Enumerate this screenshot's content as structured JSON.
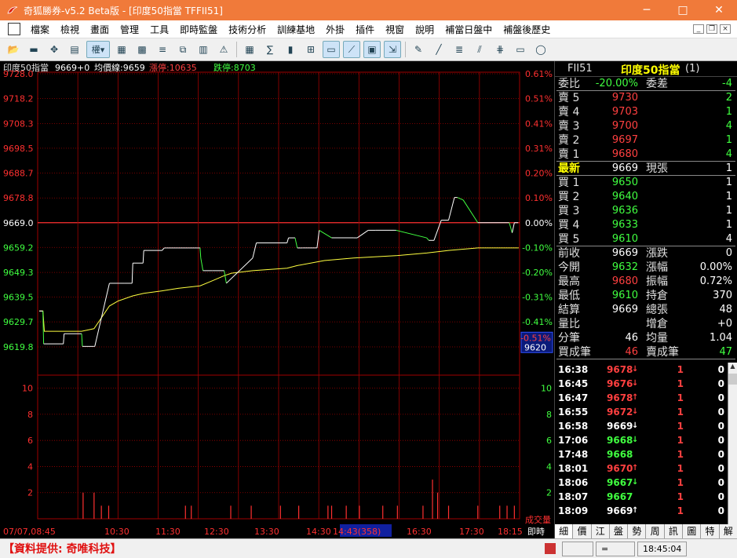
{
  "window": {
    "title": "奇狐勝券-v5.2 Beta版 - [印度50指當 TFFII51]",
    "minimize": "─",
    "maximize": "□",
    "close": "✕"
  },
  "menu": [
    "檔案",
    "檢視",
    "畫面",
    "管理",
    "工具",
    "即時監盤",
    "技術分析",
    "訓練基地",
    "外掛",
    "插件",
    "視窗",
    "說明",
    "補當日盤中",
    "補盤後歷史"
  ],
  "toolbar": {
    "weight_label": "權▾",
    "icons": [
      "open-folder-icon",
      "save-icon",
      "move-icon",
      "layout-icon",
      "weight-icon",
      "chart-grid-icon",
      "chart-grid2-icon",
      "list-icon",
      "layers-icon",
      "db-icon",
      "warning-icon",
      "table-icon",
      "sum-icon",
      "bar-chart-icon",
      "ticker-icon",
      "minute-chart-icon",
      "line-chart-icon",
      "window-icon",
      "export-icon",
      "drawing-icon",
      "line-tool-icon",
      "fib-icon",
      "fan-icon",
      "channel-icon",
      "rect-tool-icon",
      "ellipse-tool-icon"
    ]
  },
  "info_bar": {
    "name": "印度50指當",
    "price": "9669",
    "change": "+0",
    "avg_label": "均價線:9659",
    "limit_up": "漲停:10635",
    "limit_down": "跌停:8703"
  },
  "chart_data": {
    "type": "line",
    "title": "",
    "price_axis": [
      9728.0,
      9718.2,
      9708.3,
      9698.5,
      9688.7,
      9678.8,
      9669.0,
      9659.2,
      9649.3,
      9639.5,
      9629.7,
      9619.8
    ],
    "pct_axis": [
      "0.61%",
      "0.51%",
      "0.41%",
      "0.31%",
      "0.20%",
      "0.10%",
      "0.00%",
      "-0.10%",
      "-0.20%",
      "-0.31%",
      "-0.41%",
      "-0.51%"
    ],
    "ylim": [
      9619.8,
      9728.0
    ],
    "ref_price": 9669.0,
    "current_tag": {
      "pct": "-0.51%",
      "price": "9620"
    },
    "x_labels": [
      "07/07,08:45",
      "10:30",
      "11:30",
      "12:30",
      "13:30",
      "14:30",
      "14:43(358)",
      "16:30",
      "17:30",
      "18:15",
      "即時"
    ],
    "price_series": {
      "name": "",
      "t": [
        0,
        5,
        6,
        33,
        34,
        58,
        59,
        75,
        76,
        96,
        108,
        110,
        116,
        127,
        128,
        142,
        143,
        168,
        171,
        174,
        190,
        205,
        220,
        221,
        224,
        237,
        253,
        256,
        292,
        297,
        339,
        341,
        350,
        353,
        360,
        380,
        383,
        400,
        430,
        435,
        450,
        460,
        486,
        488,
        530,
        533,
        540,
        550,
        560,
        568,
        572,
        580,
        600,
        640,
        643,
        647,
        650,
        655
      ],
      "v": [
        9634,
        9634,
        9621,
        9621,
        9625,
        9625,
        9620,
        9620,
        9620,
        9645,
        9645,
        9645,
        9645,
        9645,
        9653,
        9653,
        9658,
        9658,
        9659,
        9659,
        9659,
        9659,
        9659,
        9655,
        9650,
        9650,
        9650,
        9645,
        9655,
        9661,
        9661,
        9663,
        9663,
        9659,
        9659,
        9659,
        9666,
        9663,
        9663,
        9663,
        9666,
        9666,
        9666,
        9666,
        9663,
        9662,
        9662,
        9670,
        9670,
        9679,
        9679,
        9678,
        9669,
        9669,
        9669,
        9665,
        9669,
        9669
      ]
    },
    "avg_series": {
      "name": "",
      "t": [
        0,
        5,
        7,
        33,
        58,
        75,
        96,
        108,
        128,
        143,
        168,
        190,
        220,
        237,
        253,
        263,
        292,
        339,
        353,
        390,
        430,
        490,
        530,
        560,
        600,
        640,
        656
      ],
      "v": [
        9634,
        9634,
        9626,
        9626,
        9626,
        9627,
        9636,
        9638,
        9640,
        9641,
        9642,
        9643,
        9644,
        9646,
        9648,
        9649,
        9650,
        9651,
        9652,
        9654,
        9655,
        9656,
        9657,
        9658,
        9659,
        9659,
        9659
      ]
    },
    "volume_axis": [
      10,
      8,
      6,
      4,
      2
    ],
    "volume_label": "成交量",
    "volume_ymax": 11,
    "volume_bars": [
      {
        "t": 60,
        "v": 2
      },
      {
        "t": 75,
        "v": 2
      },
      {
        "t": 85,
        "v": 1
      },
      {
        "t": 95,
        "v": 1
      },
      {
        "t": 200,
        "v": 1
      },
      {
        "t": 208,
        "v": 1
      },
      {
        "t": 262,
        "v": 1
      },
      {
        "t": 290,
        "v": 1
      },
      {
        "t": 330,
        "v": 1
      },
      {
        "t": 355,
        "v": 1
      },
      {
        "t": 395,
        "v": 1
      },
      {
        "t": 400,
        "v": 1
      },
      {
        "t": 420,
        "v": 1
      },
      {
        "t": 438,
        "v": 1
      },
      {
        "t": 470,
        "v": 1
      },
      {
        "t": 490,
        "v": 1
      },
      {
        "t": 525,
        "v": 1
      },
      {
        "t": 538,
        "v": 3
      },
      {
        "t": 545,
        "v": 2
      },
      {
        "t": 560,
        "v": 1
      },
      {
        "t": 600,
        "v": 1
      },
      {
        "t": 630,
        "v": 1
      },
      {
        "t": 640,
        "v": 1
      },
      {
        "t": 650,
        "v": 1
      }
    ]
  },
  "quote": {
    "code": "FII51",
    "name": "印度50指當",
    "suffix": "(1)",
    "rows": [
      {
        "l": "委比",
        "v": "-20.00%",
        "l2": "委差",
        "v2": "-4",
        "lc": "#e0e0e0",
        "vc": "#40ff40",
        "v2c": "#40ff40"
      },
      {
        "l": "賣 5",
        "v": "9730",
        "l2": "",
        "v2": "2",
        "lc": "#e0e0e0",
        "vc": "#ff4040",
        "v2c": "#40ff40"
      },
      {
        "l": "賣 4",
        "v": "9703",
        "l2": "",
        "v2": "1",
        "lc": "#e0e0e0",
        "vc": "#ff4040",
        "v2c": "#40ff40"
      },
      {
        "l": "賣 3",
        "v": "9700",
        "l2": "",
        "v2": "4",
        "lc": "#e0e0e0",
        "vc": "#ff4040",
        "v2c": "#40ff40"
      },
      {
        "l": "賣 2",
        "v": "9697",
        "l2": "",
        "v2": "1",
        "lc": "#e0e0e0",
        "vc": "#ff4040",
        "v2c": "#40ff40"
      },
      {
        "l": "賣 1",
        "v": "9680",
        "l2": "",
        "v2": "4",
        "lc": "#e0e0e0",
        "vc": "#ff4040",
        "v2c": "#40ff40"
      },
      {
        "l": "最新",
        "v": "9669",
        "l2": "現張",
        "v2": "1",
        "lc": "#ffff00",
        "vc": "#ffffff",
        "v2c": "#ffffff"
      },
      {
        "l": "買 1",
        "v": "9650",
        "l2": "",
        "v2": "1",
        "lc": "#e0e0e0",
        "vc": "#40ff40",
        "v2c": "#ffffff"
      },
      {
        "l": "買 2",
        "v": "9640",
        "l2": "",
        "v2": "1",
        "lc": "#e0e0e0",
        "vc": "#40ff40",
        "v2c": "#ffffff"
      },
      {
        "l": "買 3",
        "v": "9636",
        "l2": "",
        "v2": "1",
        "lc": "#e0e0e0",
        "vc": "#40ff40",
        "v2c": "#ffffff"
      },
      {
        "l": "買 4",
        "v": "9633",
        "l2": "",
        "v2": "1",
        "lc": "#e0e0e0",
        "vc": "#40ff40",
        "v2c": "#ffffff"
      },
      {
        "l": "買 5",
        "v": "9610",
        "l2": "",
        "v2": "4",
        "lc": "#e0e0e0",
        "vc": "#40ff40",
        "v2c": "#ffffff"
      },
      {
        "l": "前收",
        "v": "9669",
        "l2": "漲跌",
        "v2": "0",
        "lc": "#e0e0e0",
        "vc": "#ffffff",
        "v2c": "#ffffff"
      },
      {
        "l": "今開",
        "v": "9632",
        "l2": "漲幅",
        "v2": "0.00%",
        "lc": "#e0e0e0",
        "vc": "#40ff40",
        "v2c": "#ffffff"
      },
      {
        "l": "最高",
        "v": "9680",
        "l2": "振幅",
        "v2": "0.72%",
        "lc": "#e0e0e0",
        "vc": "#ff4040",
        "v2c": "#ffffff"
      },
      {
        "l": "最低",
        "v": "9610",
        "l2": "持倉",
        "v2": "370",
        "lc": "#e0e0e0",
        "vc": "#40ff40",
        "v2c": "#ffffff"
      },
      {
        "l": "結算",
        "v": "9669",
        "l2": "總張",
        "v2": "48",
        "lc": "#e0e0e0",
        "vc": "#ffffff",
        "v2c": "#ffffff"
      },
      {
        "l": "量比",
        "v": "",
        "l2": "增倉",
        "v2": "+0",
        "lc": "#e0e0e0",
        "vc": "#ffffff",
        "v2c": "#ffffff"
      },
      {
        "l": "分筆",
        "v": "46",
        "l2": "均量",
        "v2": "1.04",
        "lc": "#e0e0e0",
        "vc": "#ffffff",
        "v2c": "#ffffff"
      },
      {
        "l": "買成筆",
        "v": "46",
        "l2": "賣成筆",
        "v2": "47",
        "lc": "#e0e0e0",
        "vc": "#ff4040",
        "v2c": "#40ff40"
      }
    ]
  },
  "ticks": [
    {
      "time": "16:38",
      "price": "9678",
      "arrow": "↓",
      "pc": "#ff4040",
      "vol": "1",
      "chg": "0"
    },
    {
      "time": "16:45",
      "price": "9676",
      "arrow": "↓",
      "pc": "#ff4040",
      "vol": "1",
      "chg": "0"
    },
    {
      "time": "16:47",
      "price": "9678",
      "arrow": "↑",
      "pc": "#ff4040",
      "vol": "1",
      "chg": "0"
    },
    {
      "time": "16:55",
      "price": "9672",
      "arrow": "↓",
      "pc": "#ff4040",
      "vol": "1",
      "chg": "0"
    },
    {
      "time": "16:58",
      "price": "9669",
      "arrow": "↓",
      "pc": "#ffffff",
      "vol": "1",
      "chg": "0"
    },
    {
      "time": "17:06",
      "price": "9668",
      "arrow": "↓",
      "pc": "#40ff40",
      "vol": "1",
      "chg": "0"
    },
    {
      "time": "17:48",
      "price": "9668",
      "arrow": "",
      "pc": "#40ff40",
      "vol": "1",
      "chg": "0"
    },
    {
      "time": "18:01",
      "price": "9670",
      "arrow": "↑",
      "pc": "#ff4040",
      "vol": "1",
      "chg": "0"
    },
    {
      "time": "18:06",
      "price": "9667",
      "arrow": "↓",
      "pc": "#40ff40",
      "vol": "1",
      "chg": "0"
    },
    {
      "time": "18:07",
      "price": "9667",
      "arrow": "",
      "pc": "#40ff40",
      "vol": "1",
      "chg": "0"
    },
    {
      "time": "18:09",
      "price": "9669",
      "arrow": "↑",
      "pc": "#ffffff",
      "vol": "1",
      "chg": "0"
    }
  ],
  "tabs": [
    "細",
    "價",
    "江",
    "盤",
    "勢",
    "周",
    "訊",
    "圖",
    "特",
    "解"
  ],
  "status": {
    "provider": "【資料提供: 奇唯科技】",
    "cell1": "",
    "cell2": "=",
    "clock": "18:45:04"
  },
  "colors": {
    "grid": "#a00000",
    "ref_line": "#ff3030",
    "price_up": "#ffffff",
    "price_down": "#40ff40",
    "avg_line": "#ffff40",
    "volume": "#ff3030",
    "axis_text_red": "#ff3030",
    "axis_text_green": "#40ff40",
    "axis_text_white": "#ffffff",
    "titlebar": "#f07a3a"
  }
}
